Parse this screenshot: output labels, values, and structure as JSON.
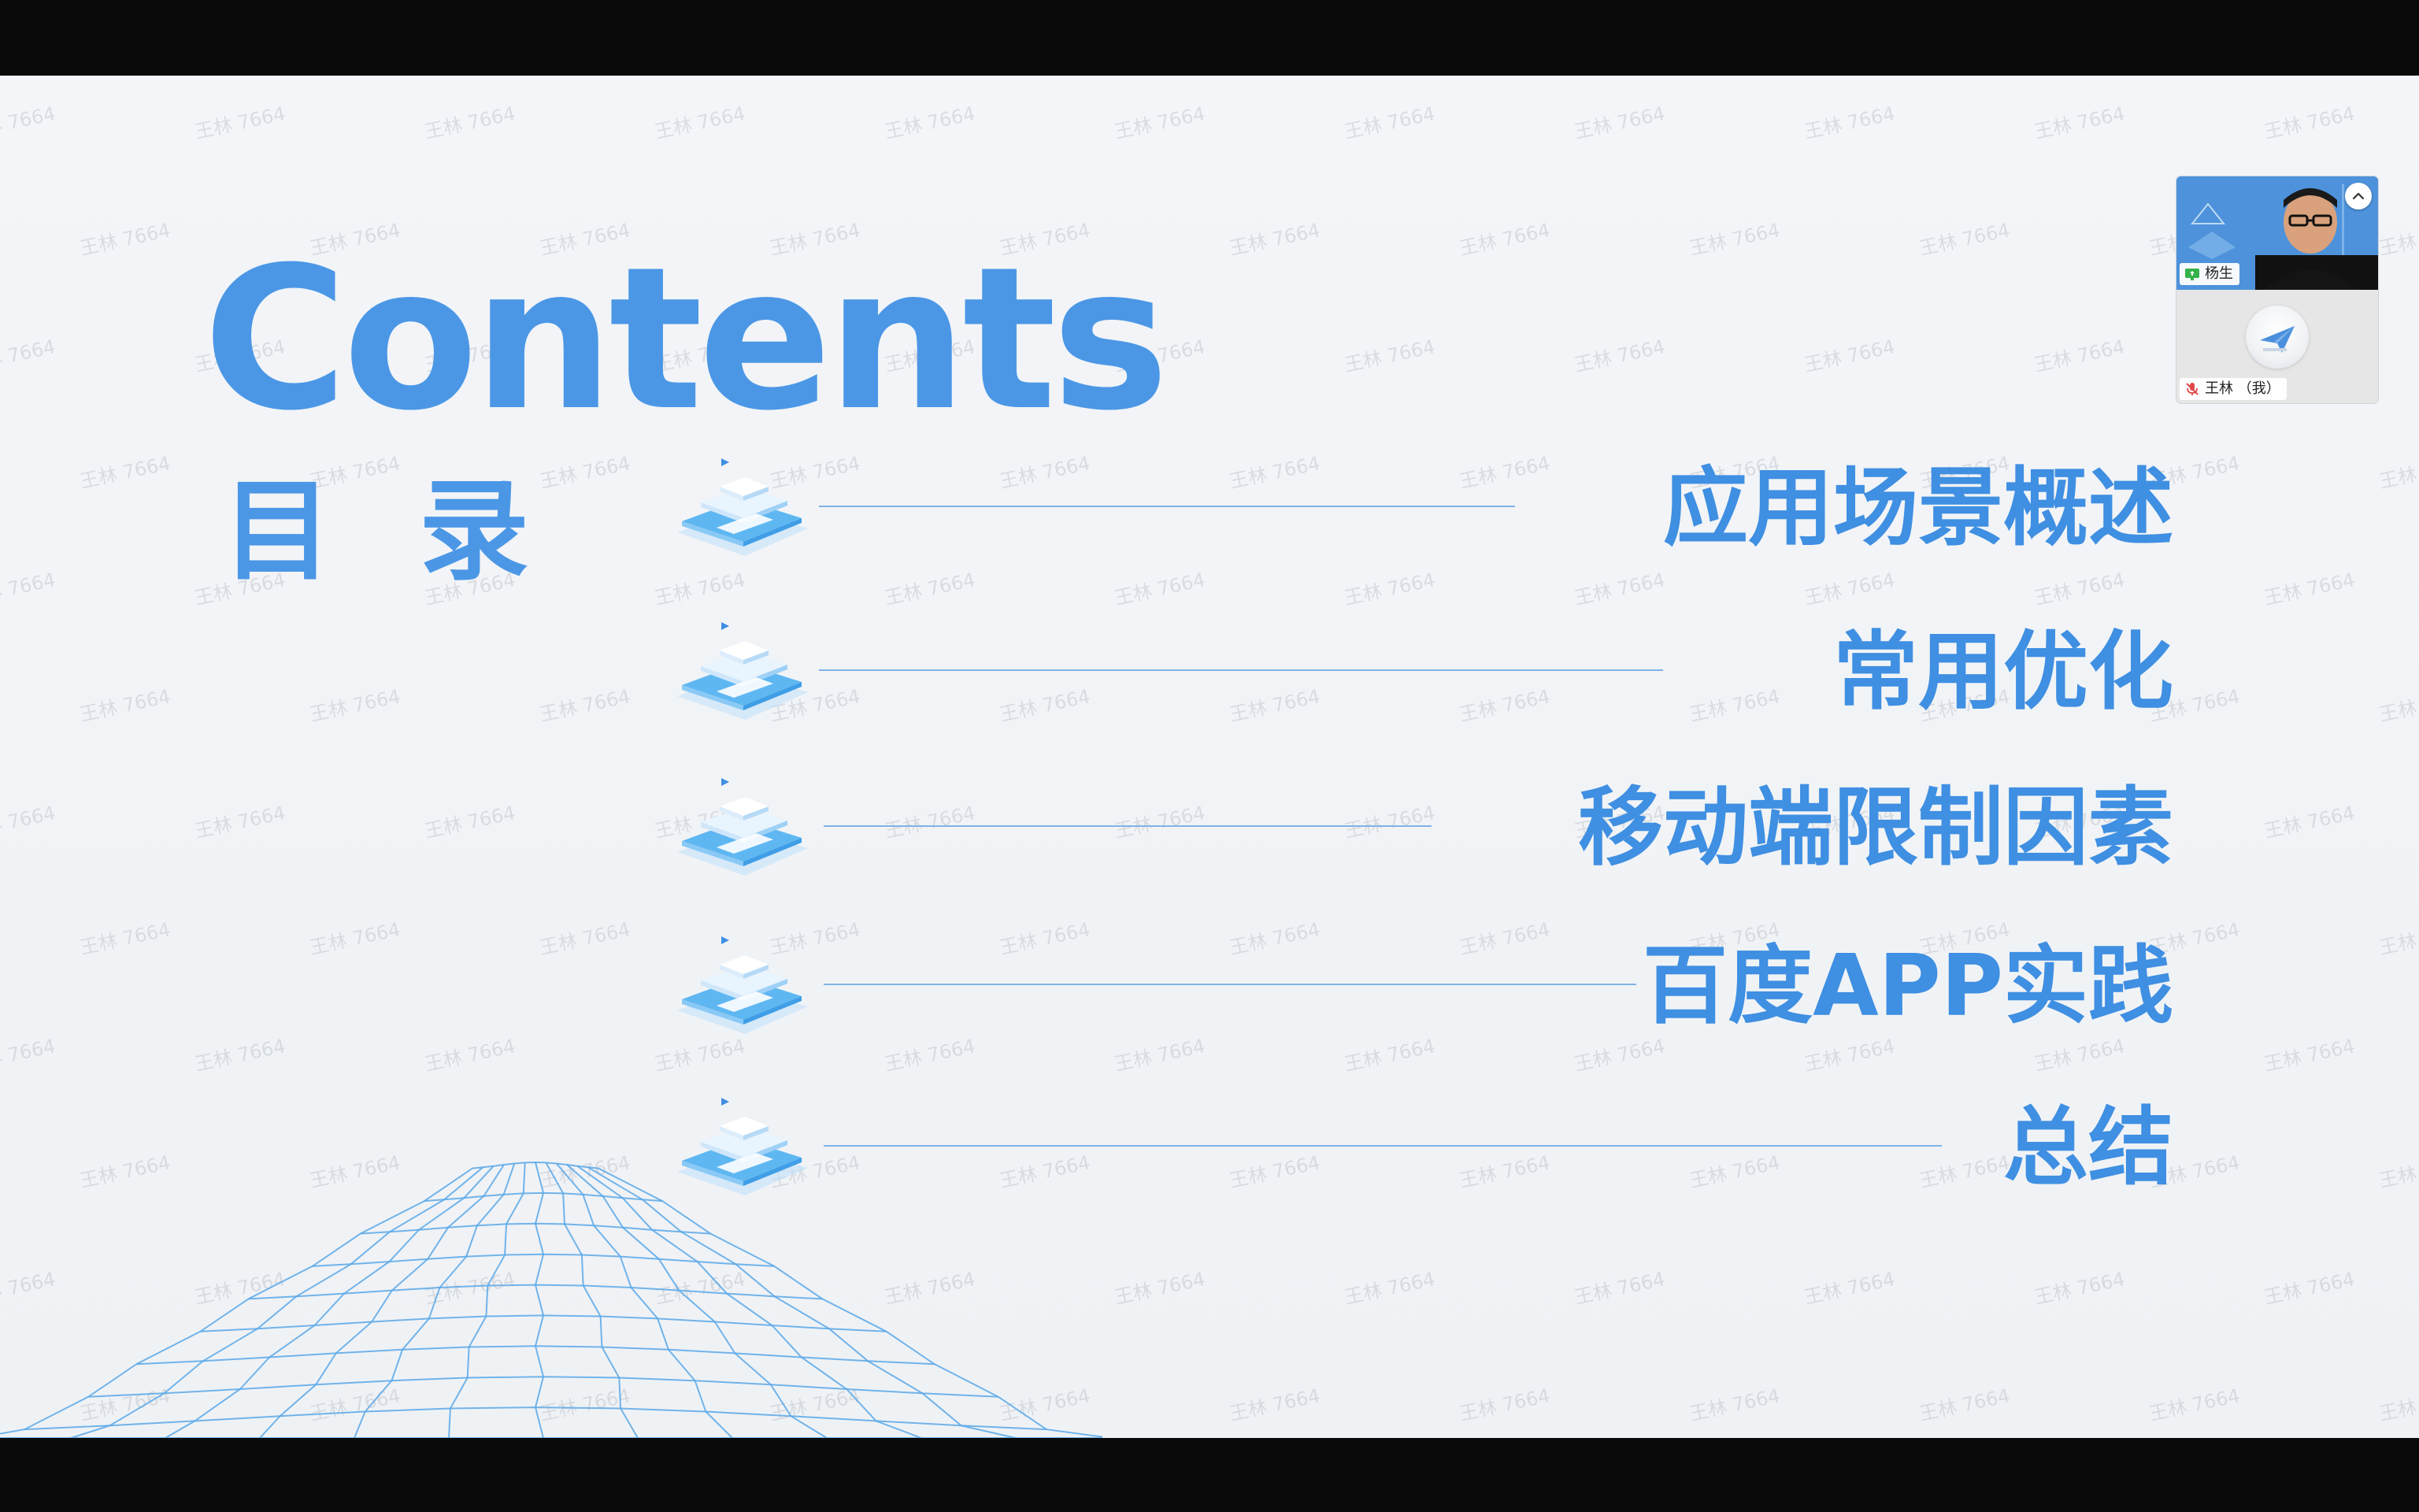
{
  "slide": {
    "title": "Contents",
    "subtitle_cn": "目录",
    "items": [
      {
        "label": "应用场景概述"
      },
      {
        "label": "常用优化"
      },
      {
        "label": "移动端限制因素"
      },
      {
        "label": "百度APP实践"
      },
      {
        "label": "总结"
      }
    ],
    "watermark_text": "王林 7664",
    "accent_color": "#4b97e6"
  },
  "meeting": {
    "participants": [
      {
        "name": "杨生",
        "status_icon": "screen-share-icon",
        "role": "presenter"
      },
      {
        "name": "王林 （我）",
        "status_icon": "mic-muted-icon",
        "role": "self"
      }
    ],
    "collapse_icon": "chevron-up-icon"
  }
}
